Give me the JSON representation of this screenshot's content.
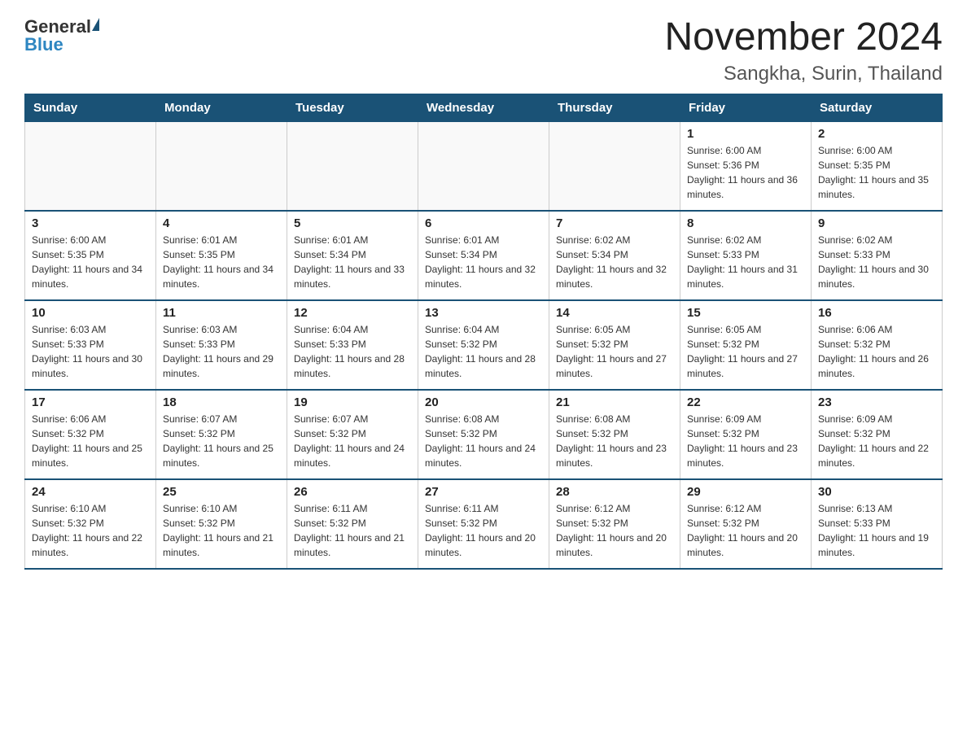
{
  "header": {
    "logo_general": "General",
    "logo_blue": "Blue",
    "title": "November 2024",
    "subtitle": "Sangkha, Surin, Thailand"
  },
  "days_of_week": [
    "Sunday",
    "Monday",
    "Tuesday",
    "Wednesday",
    "Thursday",
    "Friday",
    "Saturday"
  ],
  "weeks": [
    [
      {
        "day": "",
        "info": ""
      },
      {
        "day": "",
        "info": ""
      },
      {
        "day": "",
        "info": ""
      },
      {
        "day": "",
        "info": ""
      },
      {
        "day": "",
        "info": ""
      },
      {
        "day": "1",
        "info": "Sunrise: 6:00 AM\nSunset: 5:36 PM\nDaylight: 11 hours and 36 minutes."
      },
      {
        "day": "2",
        "info": "Sunrise: 6:00 AM\nSunset: 5:35 PM\nDaylight: 11 hours and 35 minutes."
      }
    ],
    [
      {
        "day": "3",
        "info": "Sunrise: 6:00 AM\nSunset: 5:35 PM\nDaylight: 11 hours and 34 minutes."
      },
      {
        "day": "4",
        "info": "Sunrise: 6:01 AM\nSunset: 5:35 PM\nDaylight: 11 hours and 34 minutes."
      },
      {
        "day": "5",
        "info": "Sunrise: 6:01 AM\nSunset: 5:34 PM\nDaylight: 11 hours and 33 minutes."
      },
      {
        "day": "6",
        "info": "Sunrise: 6:01 AM\nSunset: 5:34 PM\nDaylight: 11 hours and 32 minutes."
      },
      {
        "day": "7",
        "info": "Sunrise: 6:02 AM\nSunset: 5:34 PM\nDaylight: 11 hours and 32 minutes."
      },
      {
        "day": "8",
        "info": "Sunrise: 6:02 AM\nSunset: 5:33 PM\nDaylight: 11 hours and 31 minutes."
      },
      {
        "day": "9",
        "info": "Sunrise: 6:02 AM\nSunset: 5:33 PM\nDaylight: 11 hours and 30 minutes."
      }
    ],
    [
      {
        "day": "10",
        "info": "Sunrise: 6:03 AM\nSunset: 5:33 PM\nDaylight: 11 hours and 30 minutes."
      },
      {
        "day": "11",
        "info": "Sunrise: 6:03 AM\nSunset: 5:33 PM\nDaylight: 11 hours and 29 minutes."
      },
      {
        "day": "12",
        "info": "Sunrise: 6:04 AM\nSunset: 5:33 PM\nDaylight: 11 hours and 28 minutes."
      },
      {
        "day": "13",
        "info": "Sunrise: 6:04 AM\nSunset: 5:32 PM\nDaylight: 11 hours and 28 minutes."
      },
      {
        "day": "14",
        "info": "Sunrise: 6:05 AM\nSunset: 5:32 PM\nDaylight: 11 hours and 27 minutes."
      },
      {
        "day": "15",
        "info": "Sunrise: 6:05 AM\nSunset: 5:32 PM\nDaylight: 11 hours and 27 minutes."
      },
      {
        "day": "16",
        "info": "Sunrise: 6:06 AM\nSunset: 5:32 PM\nDaylight: 11 hours and 26 minutes."
      }
    ],
    [
      {
        "day": "17",
        "info": "Sunrise: 6:06 AM\nSunset: 5:32 PM\nDaylight: 11 hours and 25 minutes."
      },
      {
        "day": "18",
        "info": "Sunrise: 6:07 AM\nSunset: 5:32 PM\nDaylight: 11 hours and 25 minutes."
      },
      {
        "day": "19",
        "info": "Sunrise: 6:07 AM\nSunset: 5:32 PM\nDaylight: 11 hours and 24 minutes."
      },
      {
        "day": "20",
        "info": "Sunrise: 6:08 AM\nSunset: 5:32 PM\nDaylight: 11 hours and 24 minutes."
      },
      {
        "day": "21",
        "info": "Sunrise: 6:08 AM\nSunset: 5:32 PM\nDaylight: 11 hours and 23 minutes."
      },
      {
        "day": "22",
        "info": "Sunrise: 6:09 AM\nSunset: 5:32 PM\nDaylight: 11 hours and 23 minutes."
      },
      {
        "day": "23",
        "info": "Sunrise: 6:09 AM\nSunset: 5:32 PM\nDaylight: 11 hours and 22 minutes."
      }
    ],
    [
      {
        "day": "24",
        "info": "Sunrise: 6:10 AM\nSunset: 5:32 PM\nDaylight: 11 hours and 22 minutes."
      },
      {
        "day": "25",
        "info": "Sunrise: 6:10 AM\nSunset: 5:32 PM\nDaylight: 11 hours and 21 minutes."
      },
      {
        "day": "26",
        "info": "Sunrise: 6:11 AM\nSunset: 5:32 PM\nDaylight: 11 hours and 21 minutes."
      },
      {
        "day": "27",
        "info": "Sunrise: 6:11 AM\nSunset: 5:32 PM\nDaylight: 11 hours and 20 minutes."
      },
      {
        "day": "28",
        "info": "Sunrise: 6:12 AM\nSunset: 5:32 PM\nDaylight: 11 hours and 20 minutes."
      },
      {
        "day": "29",
        "info": "Sunrise: 6:12 AM\nSunset: 5:32 PM\nDaylight: 11 hours and 20 minutes."
      },
      {
        "day": "30",
        "info": "Sunrise: 6:13 AM\nSunset: 5:33 PM\nDaylight: 11 hours and 19 minutes."
      }
    ]
  ]
}
